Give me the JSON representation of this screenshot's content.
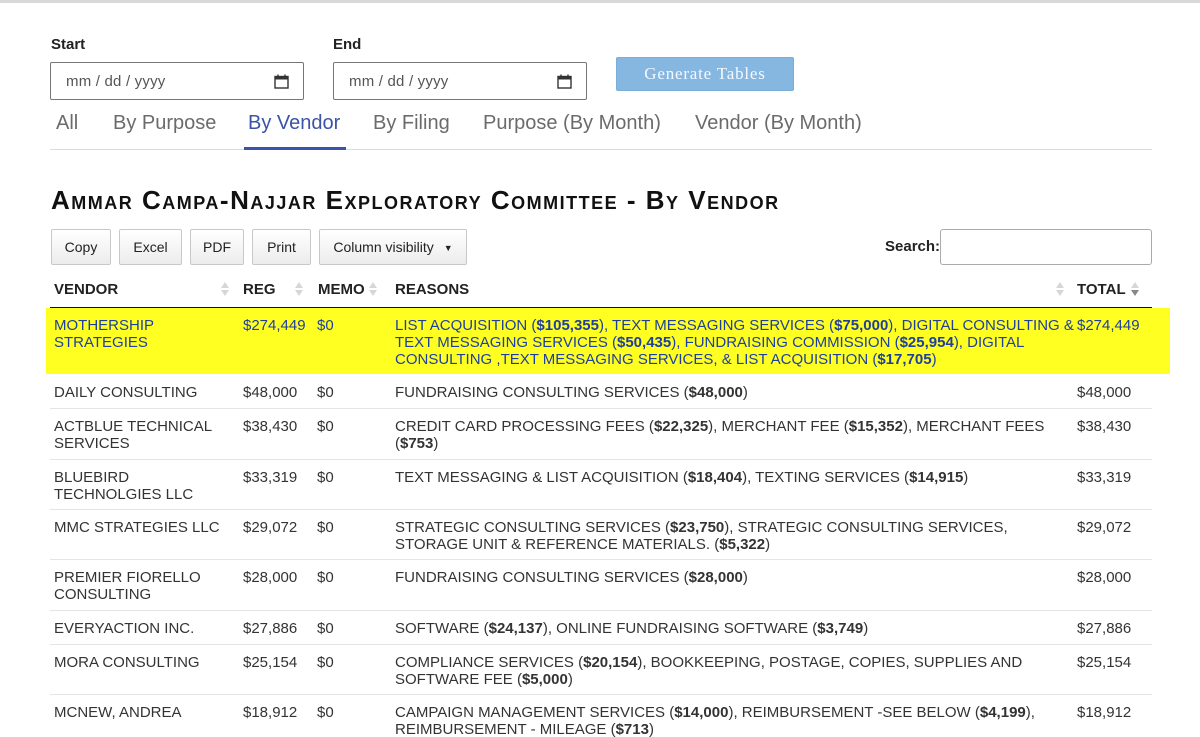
{
  "filters": {
    "start_label": "Start",
    "end_label": "End",
    "start_placeholder": "mm / dd / yyyy",
    "end_placeholder": "mm / dd / yyyy",
    "generate_button": "Generate Tables"
  },
  "tabs": [
    {
      "label": "All",
      "active": false
    },
    {
      "label": "By Purpose",
      "active": false
    },
    {
      "label": "By Vendor",
      "active": true
    },
    {
      "label": "By Filing",
      "active": false
    },
    {
      "label": "Purpose (By Month)",
      "active": false
    },
    {
      "label": "Vendor (By Month)",
      "active": false
    }
  ],
  "title": "Ammar Campa-Najjar Exploratory Committee - By Vendor",
  "toolbar": {
    "copy": "Copy",
    "excel": "Excel",
    "pdf": "PDF",
    "print": "Print",
    "column_visibility": "Column visibility",
    "search_label": "Search:"
  },
  "table": {
    "headers": {
      "vendor": "VENDOR",
      "reg": "REG",
      "memo": "MEMO",
      "reasons": "REASONS",
      "total": "TOTAL"
    },
    "sorted_column": "total",
    "sort_direction": "descending",
    "highlight_color": "#ffff22",
    "rows": [
      {
        "vendor": "MOTHERSHIP STRATEGIES",
        "reg": "$274,449",
        "memo": "$0",
        "reasons": [
          {
            "t": "LIST ACQUISITION (",
            "b": false
          },
          {
            "t": "$105,355",
            "b": true
          },
          {
            "t": "), TEXT MESSAGING SERVICES (",
            "b": false
          },
          {
            "t": "$75,000",
            "b": true
          },
          {
            "t": "), DIGITAL CONSULTING & TEXT MESSAGING SERVICES (",
            "b": false
          },
          {
            "t": "$50,435",
            "b": true
          },
          {
            "t": "), FUNDRAISING COMMISSION (",
            "b": false
          },
          {
            "t": "$25,954",
            "b": true
          },
          {
            "t": "), DIGITAL CONSULTING ,TEXT MESSAGING SERVICES, & LIST ACQUISITION (",
            "b": false
          },
          {
            "t": "$17,705",
            "b": true
          },
          {
            "t": ")",
            "b": false
          }
        ],
        "total": "$274,449",
        "highlighted": true
      },
      {
        "vendor": "DAILY CONSULTING",
        "reg": "$48,000",
        "memo": "$0",
        "reasons": [
          {
            "t": "FUNDRAISING CONSULTING SERVICES (",
            "b": false
          },
          {
            "t": "$48,000",
            "b": true
          },
          {
            "t": ")",
            "b": false
          }
        ],
        "total": "$48,000",
        "highlighted": false
      },
      {
        "vendor": "ACTBLUE TECHNICAL SERVICES",
        "reg": "$38,430",
        "memo": "$0",
        "reasons": [
          {
            "t": "CREDIT CARD PROCESSING FEES (",
            "b": false
          },
          {
            "t": "$22,325",
            "b": true
          },
          {
            "t": "), MERCHANT FEE (",
            "b": false
          },
          {
            "t": "$15,352",
            "b": true
          },
          {
            "t": "), MERCHANT FEES (",
            "b": false
          },
          {
            "t": "$753",
            "b": true
          },
          {
            "t": ")",
            "b": false
          }
        ],
        "total": "$38,430",
        "highlighted": false
      },
      {
        "vendor": "BLUEBIRD TECHNOLGIES LLC",
        "reg": "$33,319",
        "memo": "$0",
        "reasons": [
          {
            "t": "TEXT MESSAGING & LIST ACQUISITION (",
            "b": false
          },
          {
            "t": "$18,404",
            "b": true
          },
          {
            "t": "), TEXTING SERVICES (",
            "b": false
          },
          {
            "t": "$14,915",
            "b": true
          },
          {
            "t": ")",
            "b": false
          }
        ],
        "total": "$33,319",
        "highlighted": false
      },
      {
        "vendor": "MMC STRATEGIES LLC",
        "reg": "$29,072",
        "memo": "$0",
        "reasons": [
          {
            "t": "STRATEGIC CONSULTING SERVICES (",
            "b": false
          },
          {
            "t": "$23,750",
            "b": true
          },
          {
            "t": "), STRATEGIC CONSULTING SERVICES, STORAGE UNIT & REFERENCE MATERIALS. (",
            "b": false
          },
          {
            "t": "$5,322",
            "b": true
          },
          {
            "t": ")",
            "b": false
          }
        ],
        "total": "$29,072",
        "highlighted": false
      },
      {
        "vendor": "PREMIER FIORELLO CONSULTING",
        "reg": "$28,000",
        "memo": "$0",
        "reasons": [
          {
            "t": "FUNDRAISING CONSULTING SERVICES (",
            "b": false
          },
          {
            "t": "$28,000",
            "b": true
          },
          {
            "t": ")",
            "b": false
          }
        ],
        "total": "$28,000",
        "highlighted": false
      },
      {
        "vendor": "EVERYACTION INC.",
        "reg": "$27,886",
        "memo": "$0",
        "reasons": [
          {
            "t": "SOFTWARE (",
            "b": false
          },
          {
            "t": "$24,137",
            "b": true
          },
          {
            "t": "), ONLINE FUNDRAISING SOFTWARE (",
            "b": false
          },
          {
            "t": "$3,749",
            "b": true
          },
          {
            "t": ")",
            "b": false
          }
        ],
        "total": "$27,886",
        "highlighted": false
      },
      {
        "vendor": "MORA CONSULTING",
        "reg": "$25,154",
        "memo": "$0",
        "reasons": [
          {
            "t": "COMPLIANCE SERVICES (",
            "b": false
          },
          {
            "t": "$20,154",
            "b": true
          },
          {
            "t": "), BOOKKEEPING, POSTAGE, COPIES, SUPPLIES AND SOFTWARE FEE (",
            "b": false
          },
          {
            "t": "$5,000",
            "b": true
          },
          {
            "t": ")",
            "b": false
          }
        ],
        "total": "$25,154",
        "highlighted": false
      },
      {
        "vendor": "MCNEW, ANDREA",
        "reg": "$18,912",
        "memo": "$0",
        "reasons": [
          {
            "t": "CAMPAIGN MANAGEMENT SERVICES (",
            "b": false
          },
          {
            "t": "$14,000",
            "b": true
          },
          {
            "t": "), REIMBURSEMENT -SEE BELOW (",
            "b": false
          },
          {
            "t": "$4,199",
            "b": true
          },
          {
            "t": "), REIMBURSEMENT - MILEAGE (",
            "b": false
          },
          {
            "t": "$713",
            "b": true
          },
          {
            "t": ")",
            "b": false
          }
        ],
        "total": "$18,912",
        "highlighted": false
      }
    ]
  }
}
